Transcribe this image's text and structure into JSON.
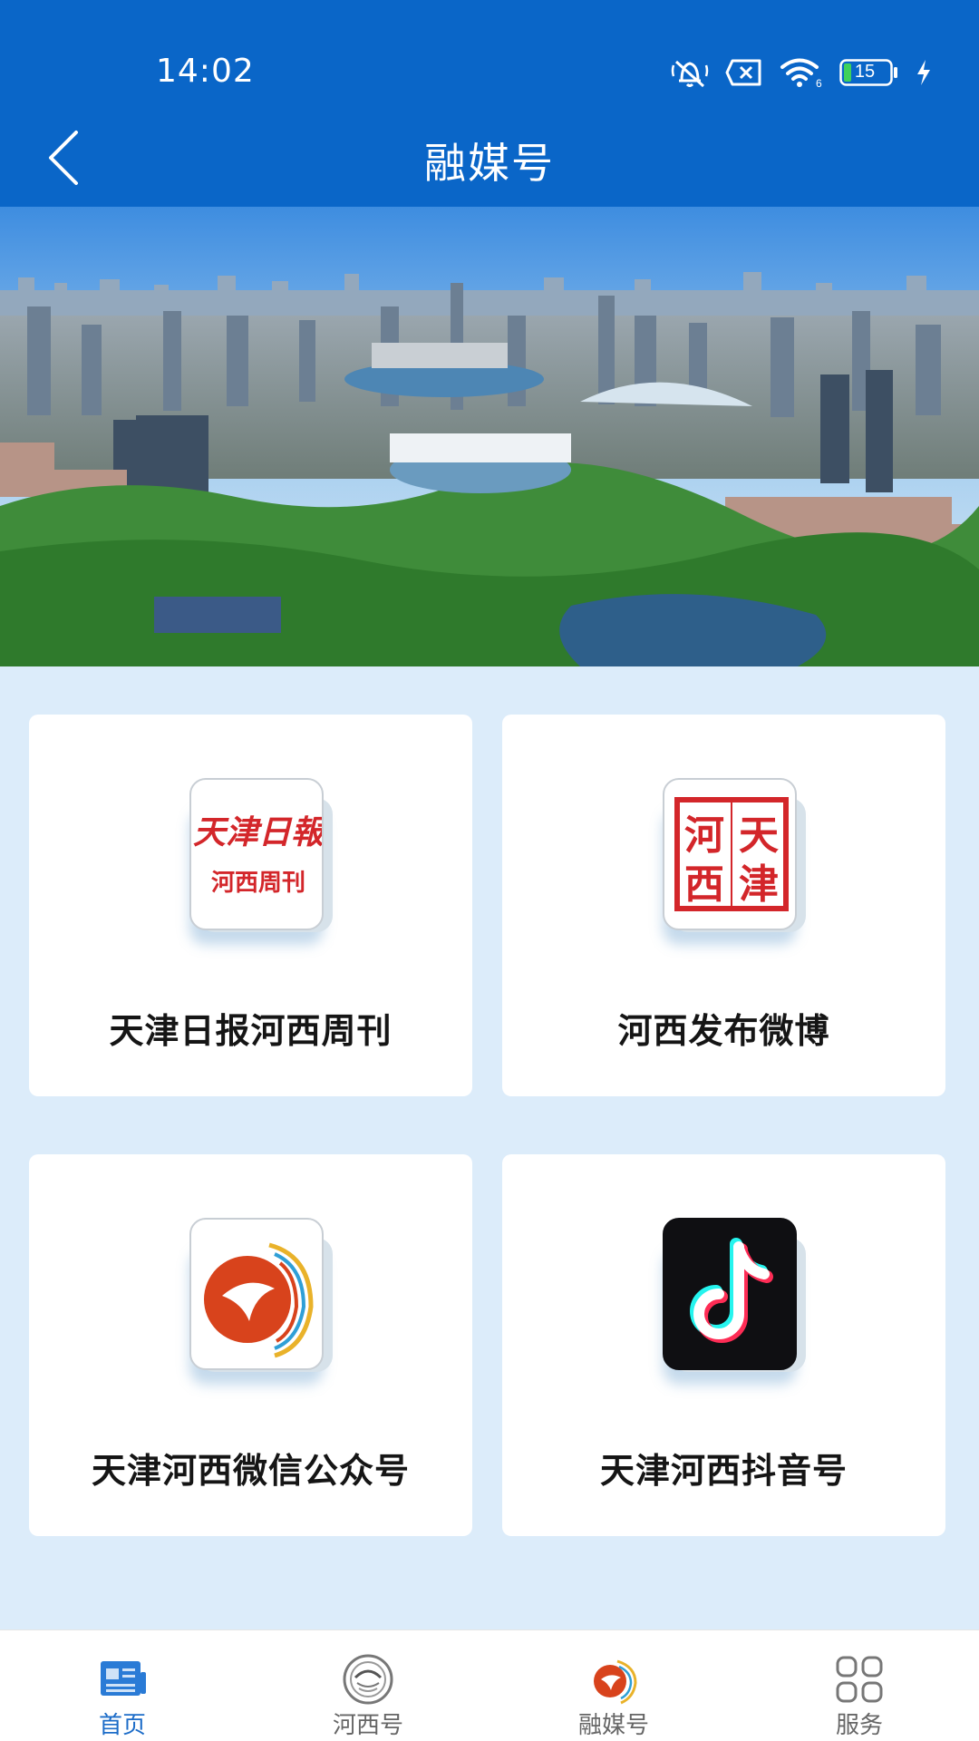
{
  "status_bar": {
    "time": "14:02",
    "battery": "15"
  },
  "nav": {
    "title": "融媒号"
  },
  "cards": [
    {
      "label": "天津日报河西周刊",
      "icon_text_top": "天津日報",
      "icon_text_bottom": "河西周刊"
    },
    {
      "label": "河西发布微博",
      "seal_chars": [
        "河",
        "天",
        "西",
        "津"
      ]
    },
    {
      "label": "天津河西微信公众号"
    },
    {
      "label": "天津河西抖音号"
    }
  ],
  "tabs": [
    {
      "label": "首页"
    },
    {
      "label": "河西号"
    },
    {
      "label": "融媒号"
    },
    {
      "label": "服务"
    }
  ],
  "colors": {
    "header": "#0a66c8",
    "page_bg": "#dcecfa",
    "active_tab": "#1c6cc8",
    "seal_red": "#d3262a"
  }
}
